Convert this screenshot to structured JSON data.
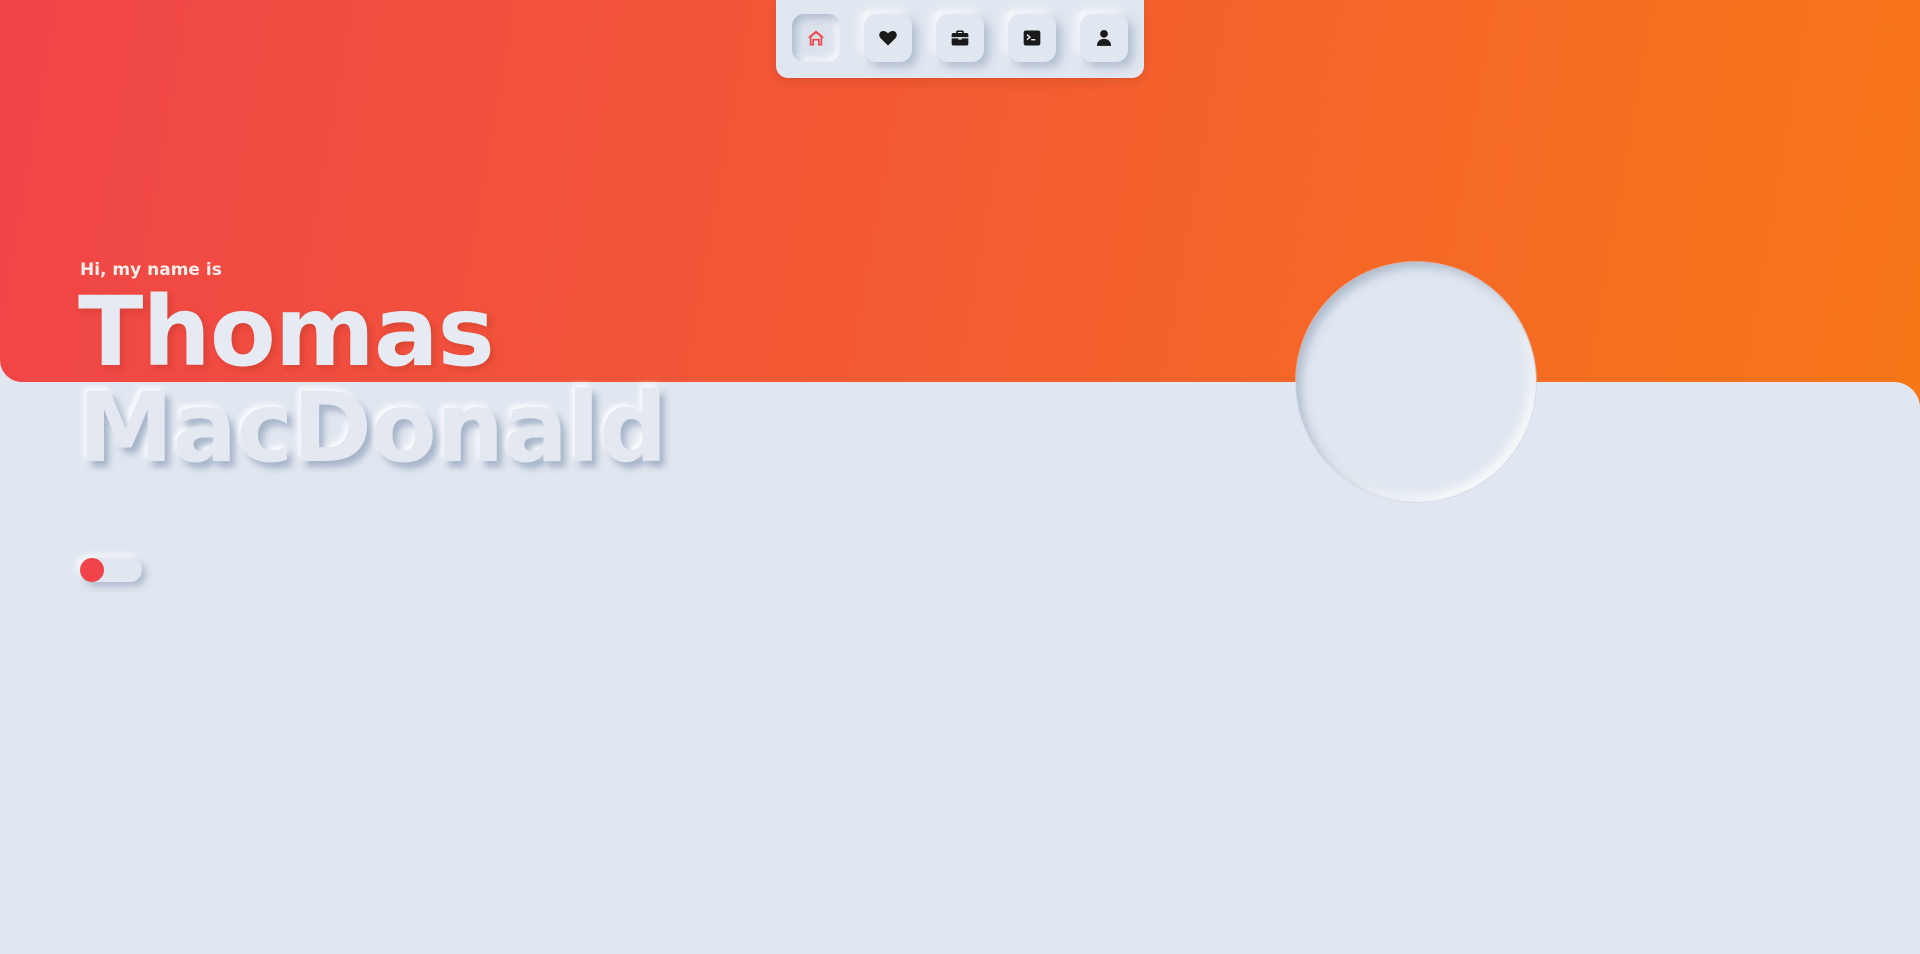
{
  "nav": {
    "items": [
      {
        "name": "home",
        "icon": "home-icon",
        "active": true
      },
      {
        "name": "favorites",
        "icon": "heart-icon",
        "active": false
      },
      {
        "name": "work",
        "icon": "briefcase-icon",
        "active": false
      },
      {
        "name": "terminal",
        "icon": "terminal-icon",
        "active": false
      },
      {
        "name": "about",
        "icon": "user-icon",
        "active": false
      }
    ]
  },
  "hero": {
    "greeting": "Hi, my name is",
    "first_name": "Thomas",
    "last_name": "MacDonald"
  },
  "theme_toggle": {
    "state": "off"
  },
  "colors": {
    "gradient_start": "#f04448",
    "gradient_end": "#f77618",
    "background": "#e1e7f0",
    "accent": "#f0444a",
    "icon": "#1a1a1a"
  }
}
